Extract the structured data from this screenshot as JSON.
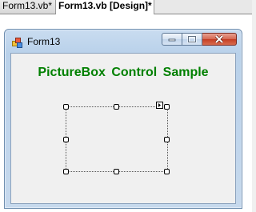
{
  "tabs": [
    {
      "label": "Form13.vb*",
      "active": false
    },
    {
      "label": "Form13.vb [Design]*",
      "active": true
    }
  ],
  "form": {
    "title": "Form13",
    "heading": "PictureBox  Control Sample"
  },
  "colors": {
    "heading": "#008000",
    "close_button": "#c43c22"
  },
  "icons": [
    "form-app-icon",
    "minimize-icon",
    "maximize-icon",
    "close-icon",
    "smart-tag-icon"
  ]
}
